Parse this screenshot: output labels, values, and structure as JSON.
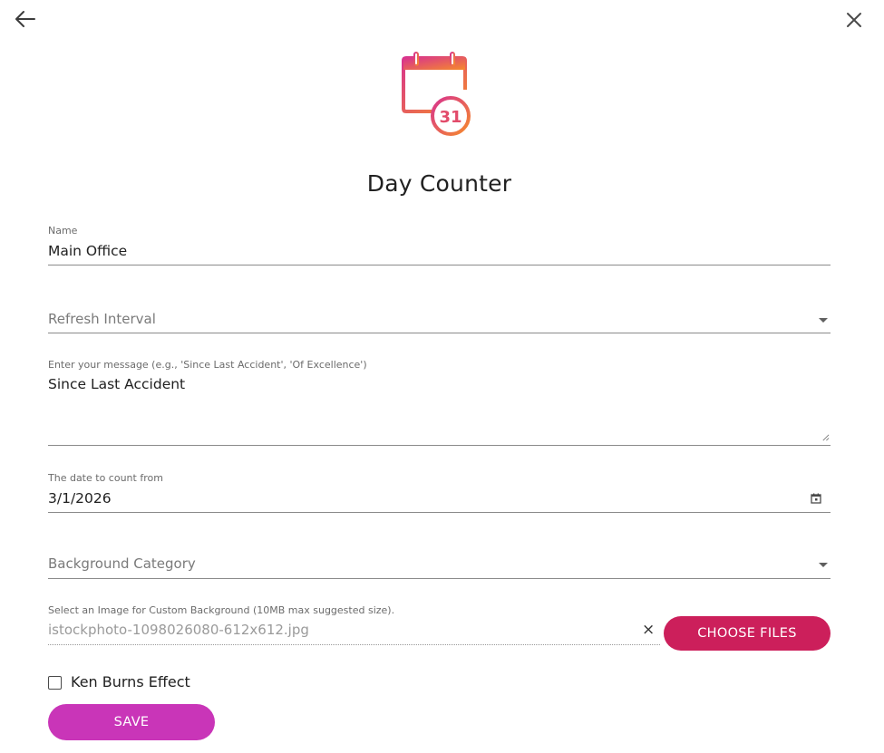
{
  "header": {
    "title": "Day Counter",
    "logo_number": "31"
  },
  "form": {
    "name": {
      "label": "Name",
      "value": "Main Office"
    },
    "refresh_interval": {
      "placeholder": "Refresh Interval",
      "value": ""
    },
    "message": {
      "label": "Enter your message (e.g., 'Since Last Accident', 'Of Excellence')",
      "value": "Since Last Accident"
    },
    "count_from": {
      "label": "The date to count from",
      "value": "3/1/2026"
    },
    "background_category": {
      "placeholder": "Background Category",
      "value": ""
    },
    "custom_background": {
      "label": "Select an Image for Custom Background (10MB max suggested size).",
      "file_name": "istockphoto-1098026080-612x612.jpg",
      "clear_label": "×",
      "choose_label": "CHOOSE FILES"
    },
    "ken_burns": {
      "label": "Ken Burns Effect",
      "checked": false
    },
    "save_label": "SAVE"
  },
  "colors": {
    "choose_button": "#cc1f5b",
    "save_button": "#c935b8",
    "logo_gradient_start": "#d8338e",
    "logo_gradient_end": "#f58a2c"
  },
  "icons": {
    "back": "arrow-left-icon",
    "close": "close-icon",
    "logo": "calendar-clock-icon",
    "dropdown": "caret-down-icon",
    "date_picker": "calendar-icon",
    "resize": "resize-handle-icon"
  }
}
